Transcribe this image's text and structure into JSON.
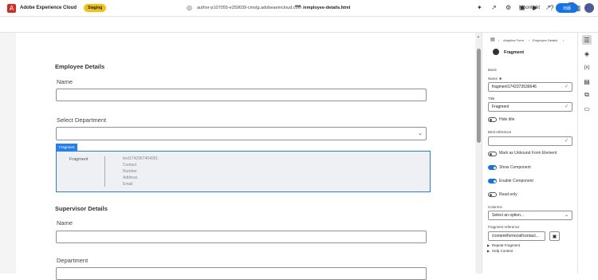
{
  "app": {
    "logo_letter": "A",
    "title": "Adobe Experience Cloud",
    "env_badge": "Staging",
    "user_name": "Moonlight",
    "notification_count": "9+"
  },
  "toolbar": {
    "url": "author-p107055-e259039-cmstg.adobeaemcloud.com",
    "url_ellipsis": "•••",
    "page_path": "/employee-details.html",
    "publish_label": "出版"
  },
  "form": {
    "employee_section": "Employee Details",
    "name_label": "Name",
    "department_label": "Select Department",
    "fragment_tag": "Fragment",
    "fragment_name": "Fragment",
    "fragment_fields": [
      "text1742367404051",
      "Contact",
      "Number",
      "Address",
      "Email"
    ],
    "supervisor_section": "Supervisor Details",
    "supervisor_name_label": "Name",
    "supervisor_department_label": "Department"
  },
  "panel": {
    "breadcrumb": [
      "Adaptive Form",
      "Employee Details"
    ],
    "component_title": "Fragment",
    "section": "Basic",
    "name_label": "Name",
    "name_value": "fragment1742373536646",
    "title_label": "Title",
    "title_value": "Fragment",
    "hide_title": "Hide title",
    "bind_reference_label": "Bind reference",
    "bind_reference_value": "",
    "unbound": "Mark as Unbound Form Element",
    "show_component": "Show Component",
    "enable_component": "Enable Component",
    "read_only": "Read-only",
    "columns_label": "Columns",
    "columns_value": "Select an option...",
    "fragment_reference_label": "Fragment reference",
    "fragment_reference_value": "/content/forms/af/contact...",
    "repeat_fragment": "Repeat Fragment",
    "help_content": "Help Content"
  },
  "colors": {
    "accent": "#1473e6",
    "selection": "#2680eb",
    "badge": "#f2c20f",
    "valid": "#2d9d78"
  }
}
